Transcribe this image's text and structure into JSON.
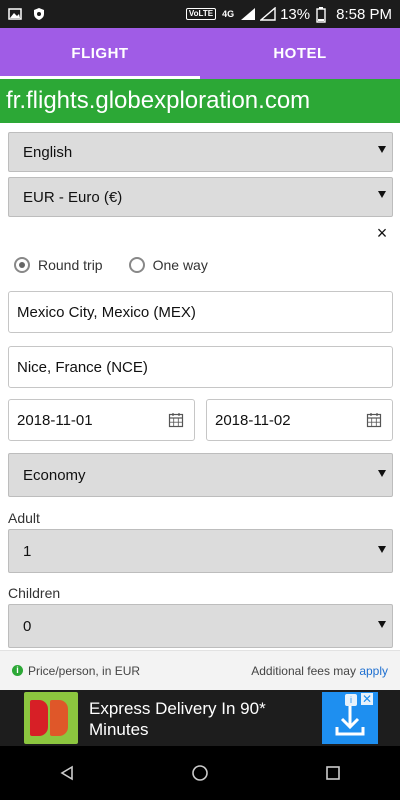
{
  "status_bar": {
    "battery": "13%",
    "time": "8:58 PM",
    "volte": "VoLTE",
    "network": "4G"
  },
  "tabs": [
    {
      "label": "FLIGHT",
      "active": true
    },
    {
      "label": "HOTEL",
      "active": false
    }
  ],
  "domain": "fr.flights.globexploration.com",
  "form": {
    "language": "English",
    "currency": "EUR - Euro (€)",
    "close_icon": "×",
    "trip_type": {
      "options": [
        "Round trip",
        "One way"
      ],
      "selected": "Round trip"
    },
    "origin": "Mexico City, Mexico (MEX)",
    "destination": "Nice, France (NCE)",
    "depart_date": "2018-11-01",
    "return_date": "2018-11-02",
    "cabin": "Economy",
    "adult_label": "Adult",
    "adult_value": "1",
    "children_label": "Children",
    "children_value": "0"
  },
  "footer": {
    "price_note": "Price/person, in EUR",
    "fees_prefix": "Additional fees may ",
    "fees_link": "apply"
  },
  "ad": {
    "text": "Express Delivery In 90* Minutes"
  },
  "colors": {
    "tab_bar": "#a05ce6",
    "domain_banner": "#2ca836",
    "link": "#1e6fd0"
  }
}
